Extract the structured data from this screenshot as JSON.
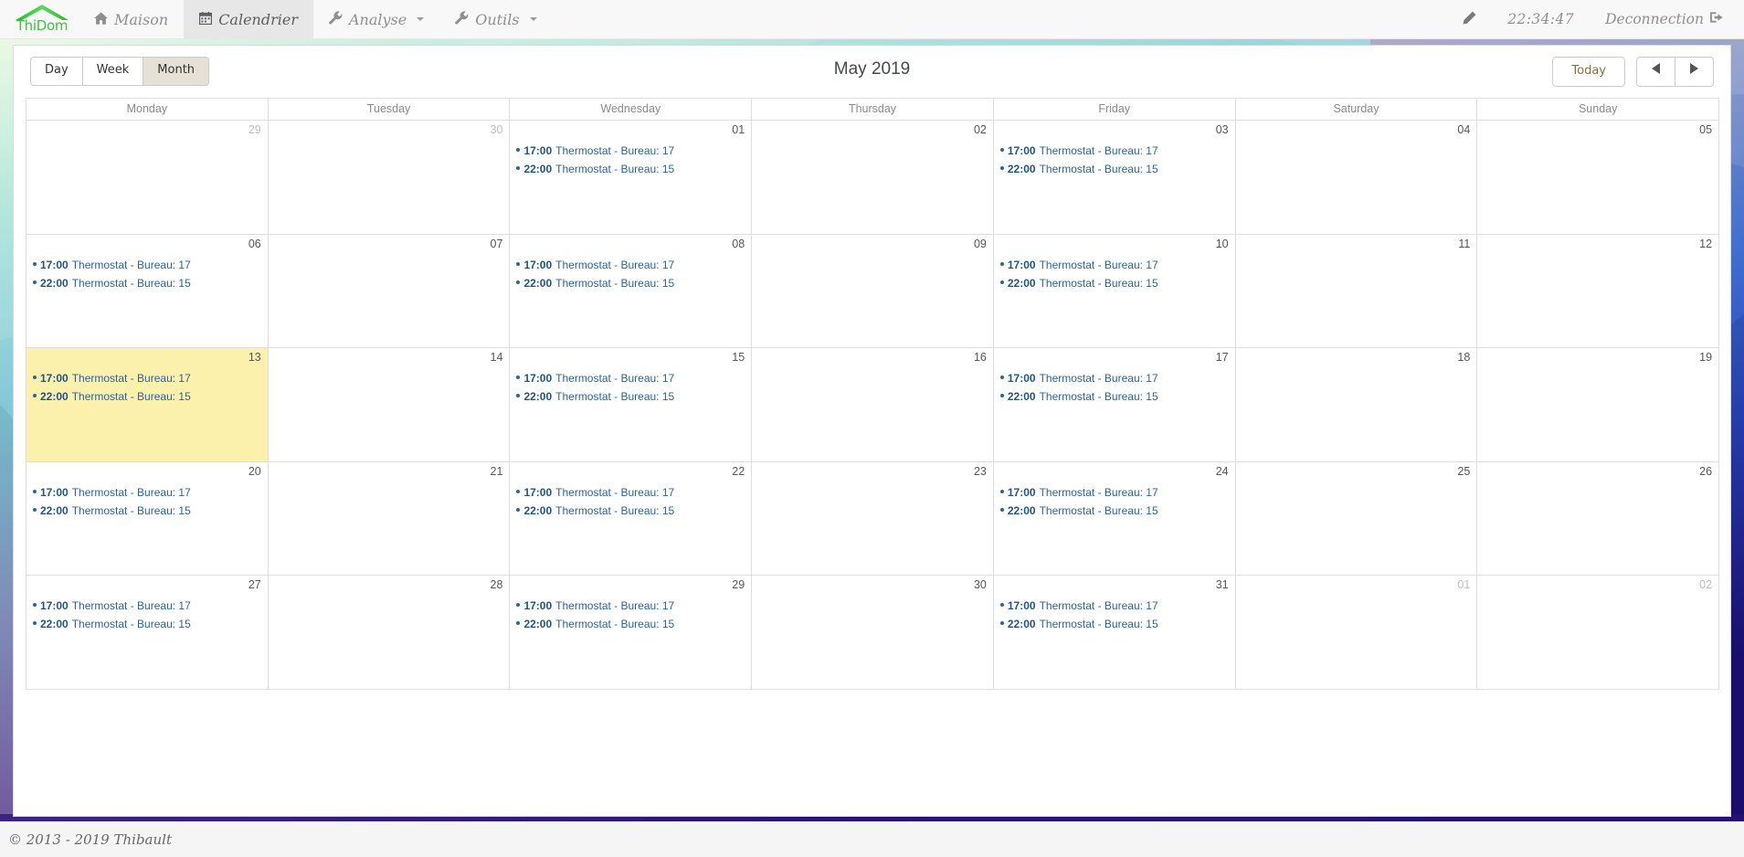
{
  "brand": {
    "name": "ThiDom",
    "icon": "house-roof-icon"
  },
  "navbar": {
    "items": [
      {
        "label": "Maison",
        "icon": "home-icon",
        "icon_glyph": "⌂",
        "active": false,
        "caret": false
      },
      {
        "label": "Calendrier",
        "icon": "calendar-icon",
        "icon_glyph": "Ὄ5",
        "active": true,
        "caret": false
      },
      {
        "label": "Analyse",
        "icon": "wrench-icon",
        "icon_glyph": "ὒ7",
        "active": false,
        "caret": true
      },
      {
        "label": "Outils",
        "icon": "wrench-icon",
        "icon_glyph": "ὒ7",
        "active": false,
        "caret": true
      }
    ],
    "edit_icon": "pencil-icon",
    "clock": "22:34:47",
    "logout_label": "Deconnection",
    "logout_icon": "sign-out-icon"
  },
  "toolbar": {
    "views": [
      {
        "label": "Day",
        "active": false
      },
      {
        "label": "Week",
        "active": false
      },
      {
        "label": "Month",
        "active": true
      }
    ],
    "title": "May 2019",
    "today_label": "Today",
    "prev_icon": "arrow-left-icon",
    "next_icon": "arrow-right-icon"
  },
  "calendar": {
    "day_headers": [
      "Monday",
      "Tuesday",
      "Wednesday",
      "Thursday",
      "Friday",
      "Saturday",
      "Sunday"
    ],
    "event_title": "Thermostat - Bureau",
    "weeks": [
      [
        {
          "num": "29",
          "other": true,
          "today": false,
          "events": []
        },
        {
          "num": "30",
          "other": true,
          "today": false,
          "events": []
        },
        {
          "num": "01",
          "other": false,
          "today": false,
          "events": [
            {
              "time": "17:00",
              "title": "Thermostat - Bureau: 17"
            },
            {
              "time": "22:00",
              "title": "Thermostat - Bureau: 15"
            }
          ]
        },
        {
          "num": "02",
          "other": false,
          "today": false,
          "events": []
        },
        {
          "num": "03",
          "other": false,
          "today": false,
          "events": [
            {
              "time": "17:00",
              "title": "Thermostat - Bureau: 17"
            },
            {
              "time": "22:00",
              "title": "Thermostat - Bureau: 15"
            }
          ]
        },
        {
          "num": "04",
          "other": false,
          "today": false,
          "events": []
        },
        {
          "num": "05",
          "other": false,
          "today": false,
          "events": []
        }
      ],
      [
        {
          "num": "06",
          "other": false,
          "today": false,
          "events": [
            {
              "time": "17:00",
              "title": "Thermostat - Bureau: 17"
            },
            {
              "time": "22:00",
              "title": "Thermostat - Bureau: 15"
            }
          ]
        },
        {
          "num": "07",
          "other": false,
          "today": false,
          "events": []
        },
        {
          "num": "08",
          "other": false,
          "today": false,
          "events": [
            {
              "time": "17:00",
              "title": "Thermostat - Bureau: 17"
            },
            {
              "time": "22:00",
              "title": "Thermostat - Bureau: 15"
            }
          ]
        },
        {
          "num": "09",
          "other": false,
          "today": false,
          "events": []
        },
        {
          "num": "10",
          "other": false,
          "today": false,
          "events": [
            {
              "time": "17:00",
              "title": "Thermostat - Bureau: 17"
            },
            {
              "time": "22:00",
              "title": "Thermostat - Bureau: 15"
            }
          ]
        },
        {
          "num": "11",
          "other": false,
          "today": false,
          "events": []
        },
        {
          "num": "12",
          "other": false,
          "today": false,
          "events": []
        }
      ],
      [
        {
          "num": "13",
          "other": false,
          "today": true,
          "events": [
            {
              "time": "17:00",
              "title": "Thermostat - Bureau: 17"
            },
            {
              "time": "22:00",
              "title": "Thermostat - Bureau: 15"
            }
          ]
        },
        {
          "num": "14",
          "other": false,
          "today": false,
          "events": []
        },
        {
          "num": "15",
          "other": false,
          "today": false,
          "events": [
            {
              "time": "17:00",
              "title": "Thermostat - Bureau: 17"
            },
            {
              "time": "22:00",
              "title": "Thermostat - Bureau: 15"
            }
          ]
        },
        {
          "num": "16",
          "other": false,
          "today": false,
          "events": []
        },
        {
          "num": "17",
          "other": false,
          "today": false,
          "events": [
            {
              "time": "17:00",
              "title": "Thermostat - Bureau: 17"
            },
            {
              "time": "22:00",
              "title": "Thermostat - Bureau: 15"
            }
          ]
        },
        {
          "num": "18",
          "other": false,
          "today": false,
          "events": []
        },
        {
          "num": "19",
          "other": false,
          "today": false,
          "events": []
        }
      ],
      [
        {
          "num": "20",
          "other": false,
          "today": false,
          "events": [
            {
              "time": "17:00",
              "title": "Thermostat - Bureau: 17"
            },
            {
              "time": "22:00",
              "title": "Thermostat - Bureau: 15"
            }
          ]
        },
        {
          "num": "21",
          "other": false,
          "today": false,
          "events": []
        },
        {
          "num": "22",
          "other": false,
          "today": false,
          "events": [
            {
              "time": "17:00",
              "title": "Thermostat - Bureau: 17"
            },
            {
              "time": "22:00",
              "title": "Thermostat - Bureau: 15"
            }
          ]
        },
        {
          "num": "23",
          "other": false,
          "today": false,
          "events": []
        },
        {
          "num": "24",
          "other": false,
          "today": false,
          "events": [
            {
              "time": "17:00",
              "title": "Thermostat - Bureau: 17"
            },
            {
              "time": "22:00",
              "title": "Thermostat - Bureau: 15"
            }
          ]
        },
        {
          "num": "25",
          "other": false,
          "today": false,
          "events": []
        },
        {
          "num": "26",
          "other": false,
          "today": false,
          "events": []
        }
      ],
      [
        {
          "num": "27",
          "other": false,
          "today": false,
          "events": [
            {
              "time": "17:00",
              "title": "Thermostat - Bureau: 17"
            },
            {
              "time": "22:00",
              "title": "Thermostat - Bureau: 15"
            }
          ]
        },
        {
          "num": "28",
          "other": false,
          "today": false,
          "events": []
        },
        {
          "num": "29",
          "other": false,
          "today": false,
          "events": [
            {
              "time": "17:00",
              "title": "Thermostat - Bureau: 17"
            },
            {
              "time": "22:00",
              "title": "Thermostat - Bureau: 15"
            }
          ]
        },
        {
          "num": "30",
          "other": false,
          "today": false,
          "events": []
        },
        {
          "num": "31",
          "other": false,
          "today": false,
          "events": [
            {
              "time": "17:00",
              "title": "Thermostat - Bureau: 17"
            },
            {
              "time": "22:00",
              "title": "Thermostat - Bureau: 15"
            }
          ]
        },
        {
          "num": "01",
          "other": true,
          "today": false,
          "events": []
        },
        {
          "num": "02",
          "other": true,
          "today": false,
          "events": []
        }
      ]
    ]
  },
  "footer": {
    "copyright": "© 2013 - 2019 Thibault"
  },
  "colors": {
    "brand_green": "#3fc23f",
    "event_blue": "#2a6496",
    "today_yellow": "#fcf0ad",
    "navbar_bg": "#f8f8f8",
    "active_tab_bg": "#e7e7e7",
    "today_btn_text": "#8a6d3b"
  }
}
